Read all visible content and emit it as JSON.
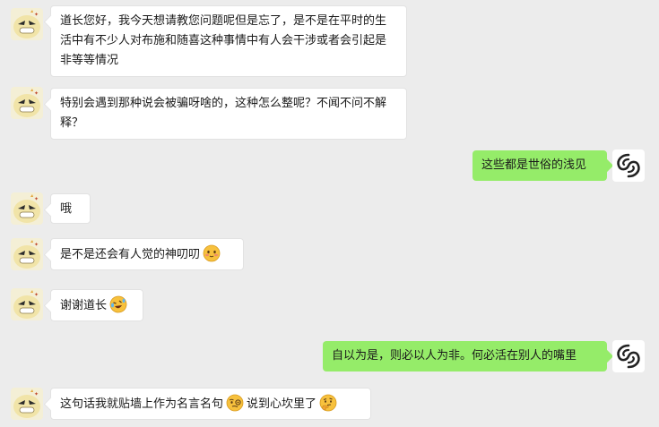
{
  "messages": [
    {
      "side": "left",
      "text": "道长您好，我今天想请教您问题呢但是忘了，是不是在平时的生活中有不少人对布施和随喜这种事情中有人会干涉或者会引起是非等等情况"
    },
    {
      "side": "left",
      "text": "特别会遇到那种说会被骗呀啥的，这种怎么整呢？不闻不问不解释？"
    },
    {
      "side": "right",
      "text": "这些都是世俗的浅见"
    },
    {
      "side": "left",
      "text": "哦"
    },
    {
      "side": "left",
      "text": "是不是还会有人觉的神叨叨",
      "emoji": "blush-emoji"
    },
    {
      "side": "left",
      "text": "谢谢道长",
      "emoji": "laughing-tears-emoji"
    },
    {
      "side": "right",
      "text": "自以为是，则必以人为非。何必活在别人的嘴里"
    },
    {
      "side": "left",
      "text": "这句话我就贴墙上作为名言名句",
      "emoji": "smart-emoji",
      "text2": "说到心坎里了",
      "emoji2": "thinking-emoji"
    }
  ],
  "avatars": {
    "user": "cartoon-duck-avatar",
    "daoist": "yin-yang-swirl-avatar"
  },
  "colors": {
    "background": "#ececec",
    "left_bubble": "#ffffff",
    "right_bubble": "#95ec69"
  }
}
